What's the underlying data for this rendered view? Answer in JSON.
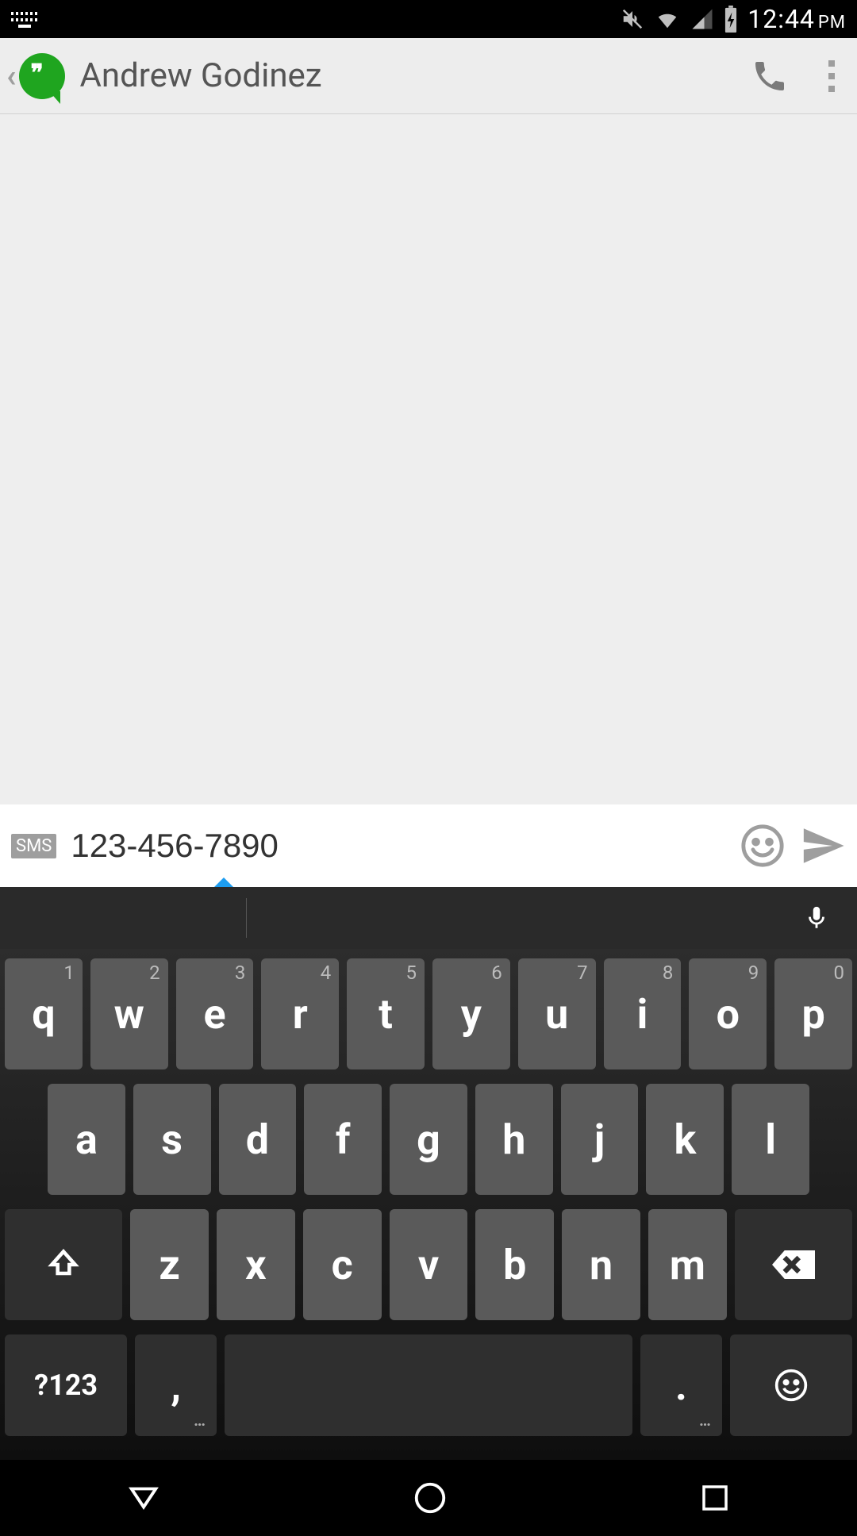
{
  "status": {
    "time": "12:44",
    "ampm": "PM"
  },
  "appbar": {
    "contact_name": "Andrew Godinez"
  },
  "compose": {
    "sms_badge": "SMS",
    "input_value": "123-456-7890"
  },
  "keyboard": {
    "row1": [
      {
        "main": "q",
        "hint": "1"
      },
      {
        "main": "w",
        "hint": "2"
      },
      {
        "main": "e",
        "hint": "3"
      },
      {
        "main": "r",
        "hint": "4"
      },
      {
        "main": "t",
        "hint": "5"
      },
      {
        "main": "y",
        "hint": "6"
      },
      {
        "main": "u",
        "hint": "7"
      },
      {
        "main": "i",
        "hint": "8"
      },
      {
        "main": "o",
        "hint": "9"
      },
      {
        "main": "p",
        "hint": "0"
      }
    ],
    "row2": [
      "a",
      "s",
      "d",
      "f",
      "g",
      "h",
      "j",
      "k",
      "l"
    ],
    "row3": [
      "z",
      "x",
      "c",
      "v",
      "b",
      "n",
      "m"
    ],
    "symkey": "?123",
    "comma": ",",
    "period": "."
  }
}
